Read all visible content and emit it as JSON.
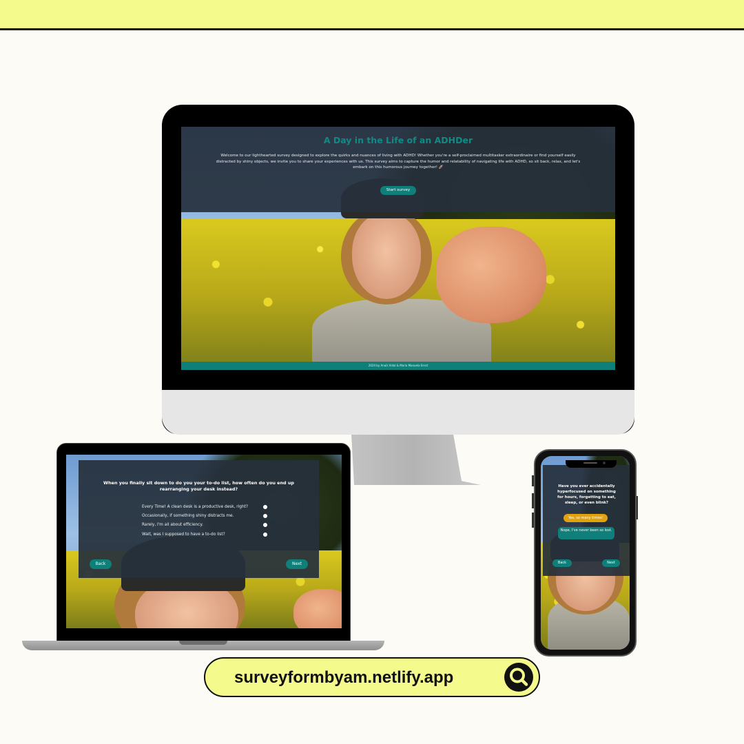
{
  "desktop": {
    "title": "A Day in the Life of an ADHDer",
    "description": "Welcome to our lighthearted survey designed to explore the quirks and nuances of living with ADHD! Whether you're a self-proclaimed multitasker extraordinaire or find yourself easily distracted by shiny objects, we invite you to share your experiences with us. This survey aims to capture the humor and relatability of navigating life with ADHD, so sit back, relax, and let's embark on this humorous journey together! 🚀",
    "start_button": "Start survey",
    "footer": "2024 by Anaïs Vidal & María Manuela Ernst"
  },
  "laptop": {
    "question": "When you finally sit down to do you your to-do list, how often do you end up rearranging your desk instead?",
    "options": [
      "Every Time! A clean desk is a productive desk, right?",
      "Occasionally, if something shiny distracts me.",
      "Rarely, I'm all about efficiency.",
      "Wait, was I supposed to have a to-do list?"
    ],
    "back_button": "Back",
    "next_button": "Next"
  },
  "phone": {
    "question": "Have you ever accidentally hyperfocused on something for hours, forgetting to eat, sleep, or even blink?",
    "answer_yes": "Yes, so many times!",
    "answer_no": "Nope, I've never been so lost.",
    "back_button": "Back",
    "next_button": "Next"
  },
  "url_bar": {
    "text": "surveyformbyam.netlify.app",
    "icon": "search-icon"
  },
  "colors": {
    "accent_teal": "#0f7f7a",
    "title_teal": "#0f8b85",
    "highlight_yellow": "#f4fa8c",
    "answer_gold": "#e0a30e"
  }
}
